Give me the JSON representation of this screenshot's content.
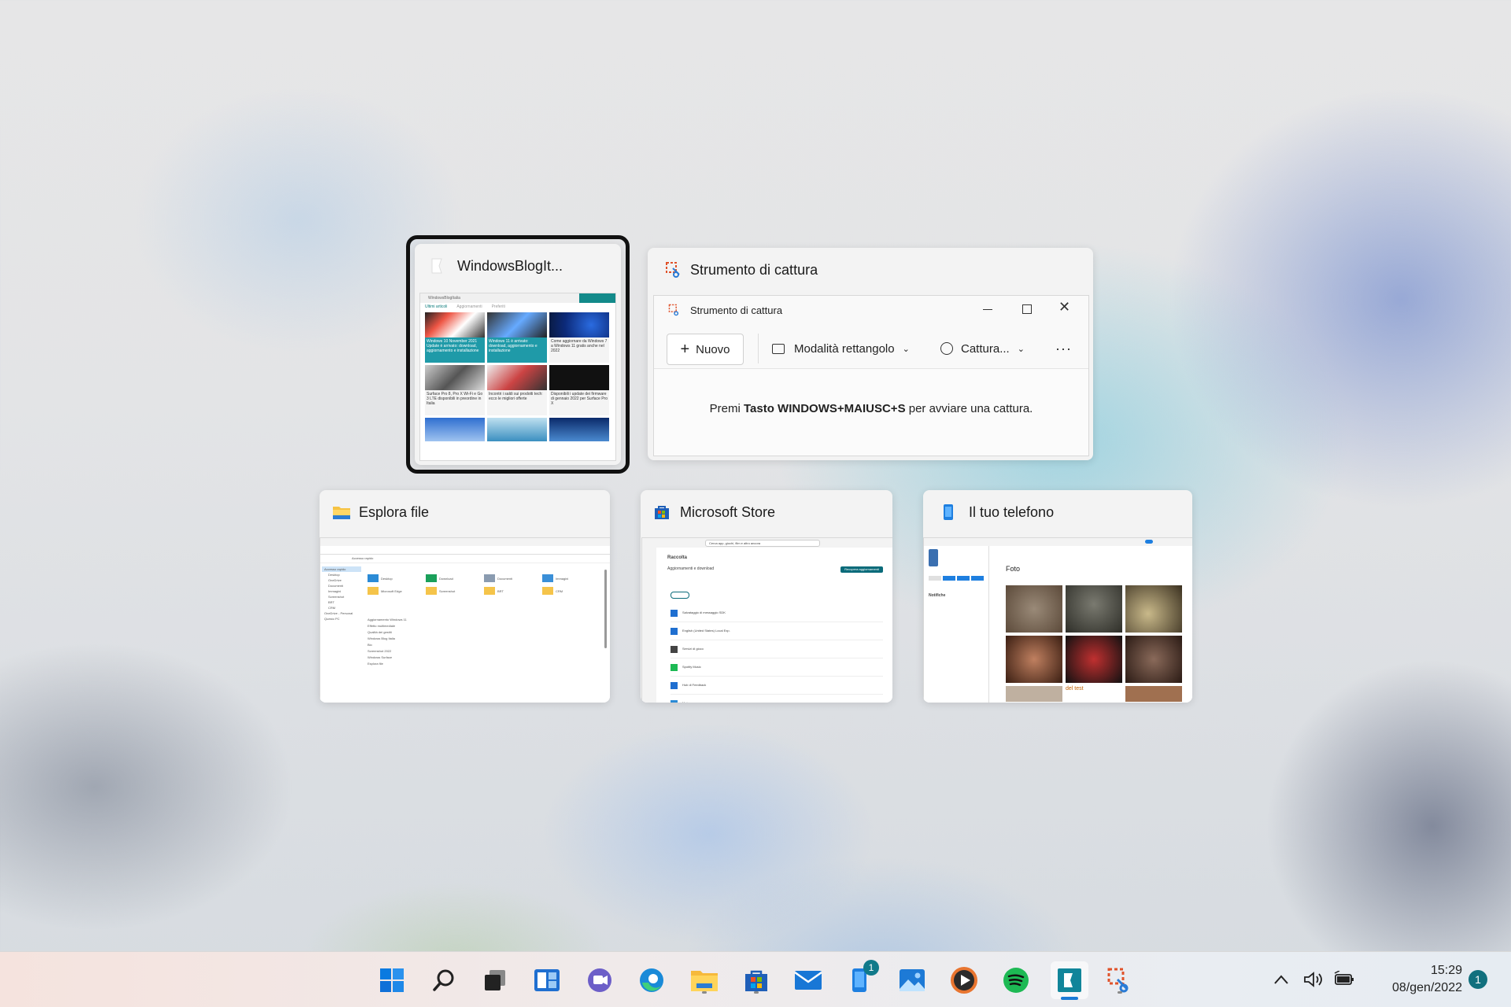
{
  "windows": [
    {
      "title": "WindowsBlogIt..."
    },
    {
      "title": "Strumento di cattura"
    },
    {
      "title": "Esplora file"
    },
    {
      "title": "Microsoft Store"
    },
    {
      "title": "Il tuo telefono"
    }
  ],
  "snip": {
    "window_title": "Strumento di cattura",
    "new_label": "Nuovo",
    "mode_label": "Modalità rettangolo",
    "delay_label": "Cattura...",
    "hint_prefix": "Premi ",
    "hint_shortcut": "Tasto WINDOWS+MAIUSC+S",
    "hint_suffix": " per avviare una cattura."
  },
  "blog_preview": {
    "site": "WindowsBlogItalia",
    "tabs": [
      "Ultimi articoli",
      "Aggiornamenti",
      "Preferiti"
    ],
    "tiles": [
      "Windows 10 November 2021 Update è arrivato: download, aggiornamento e installazione",
      "Windows 11 è arrivato: download, aggiornamento e installazione",
      "Come aggiornare da Windows 7 a Windows 11 gratis anche nel 2022",
      "Surface Pro 8, Pro X Wi-Fi e Go 3 LTE disponibili in preordine in Italia",
      "Incontri i saldi sui prodotti tech: ecco le migliori offerte",
      "Disponibili i update dei firmware di gennaio 2022 per Surface Pro X"
    ]
  },
  "explorer_preview": {
    "address": "Accesso rapido",
    "folders": [
      "Desktop",
      "Download",
      "Documenti",
      "Immagini",
      "Microsoft Edge",
      "Screenshot",
      "BRT",
      "CRM"
    ],
    "sidebar": [
      "Accesso rapido",
      "Desktop",
      "OneDrive",
      "Documenti",
      "Immagini",
      "Screenshot",
      "BRT",
      "CRM",
      "OneDrive - Personal",
      "Questo PC"
    ],
    "files": [
      "Aggiornamento Windows 11",
      "Effetto multimediale",
      "Qualità dei gestiti",
      "Windows Blog Italia",
      "Bio",
      "Screenshot 2022",
      "Windows Surface",
      "Esplora file"
    ]
  },
  "store_preview": {
    "search": "Cerca app, giochi, film e altro ancora",
    "heading": "Raccolta",
    "subheading": "Aggiornamenti e download",
    "update_btn": "Recupera aggiornamenti",
    "rows": [
      "Salvataggio di messaggio SDK",
      "English (United States) Local Exp.",
      "Servizi di gioco",
      "Spotify Music",
      "Hub di Feedback",
      "Meteo"
    ]
  },
  "phone_preview": {
    "section": "Foto",
    "notifications": "Notifiche",
    "caption": "del test"
  },
  "taskbar": {
    "badge_count": "1",
    "time": "15:29",
    "date": "08/gen/2022",
    "notification_count": "1"
  }
}
